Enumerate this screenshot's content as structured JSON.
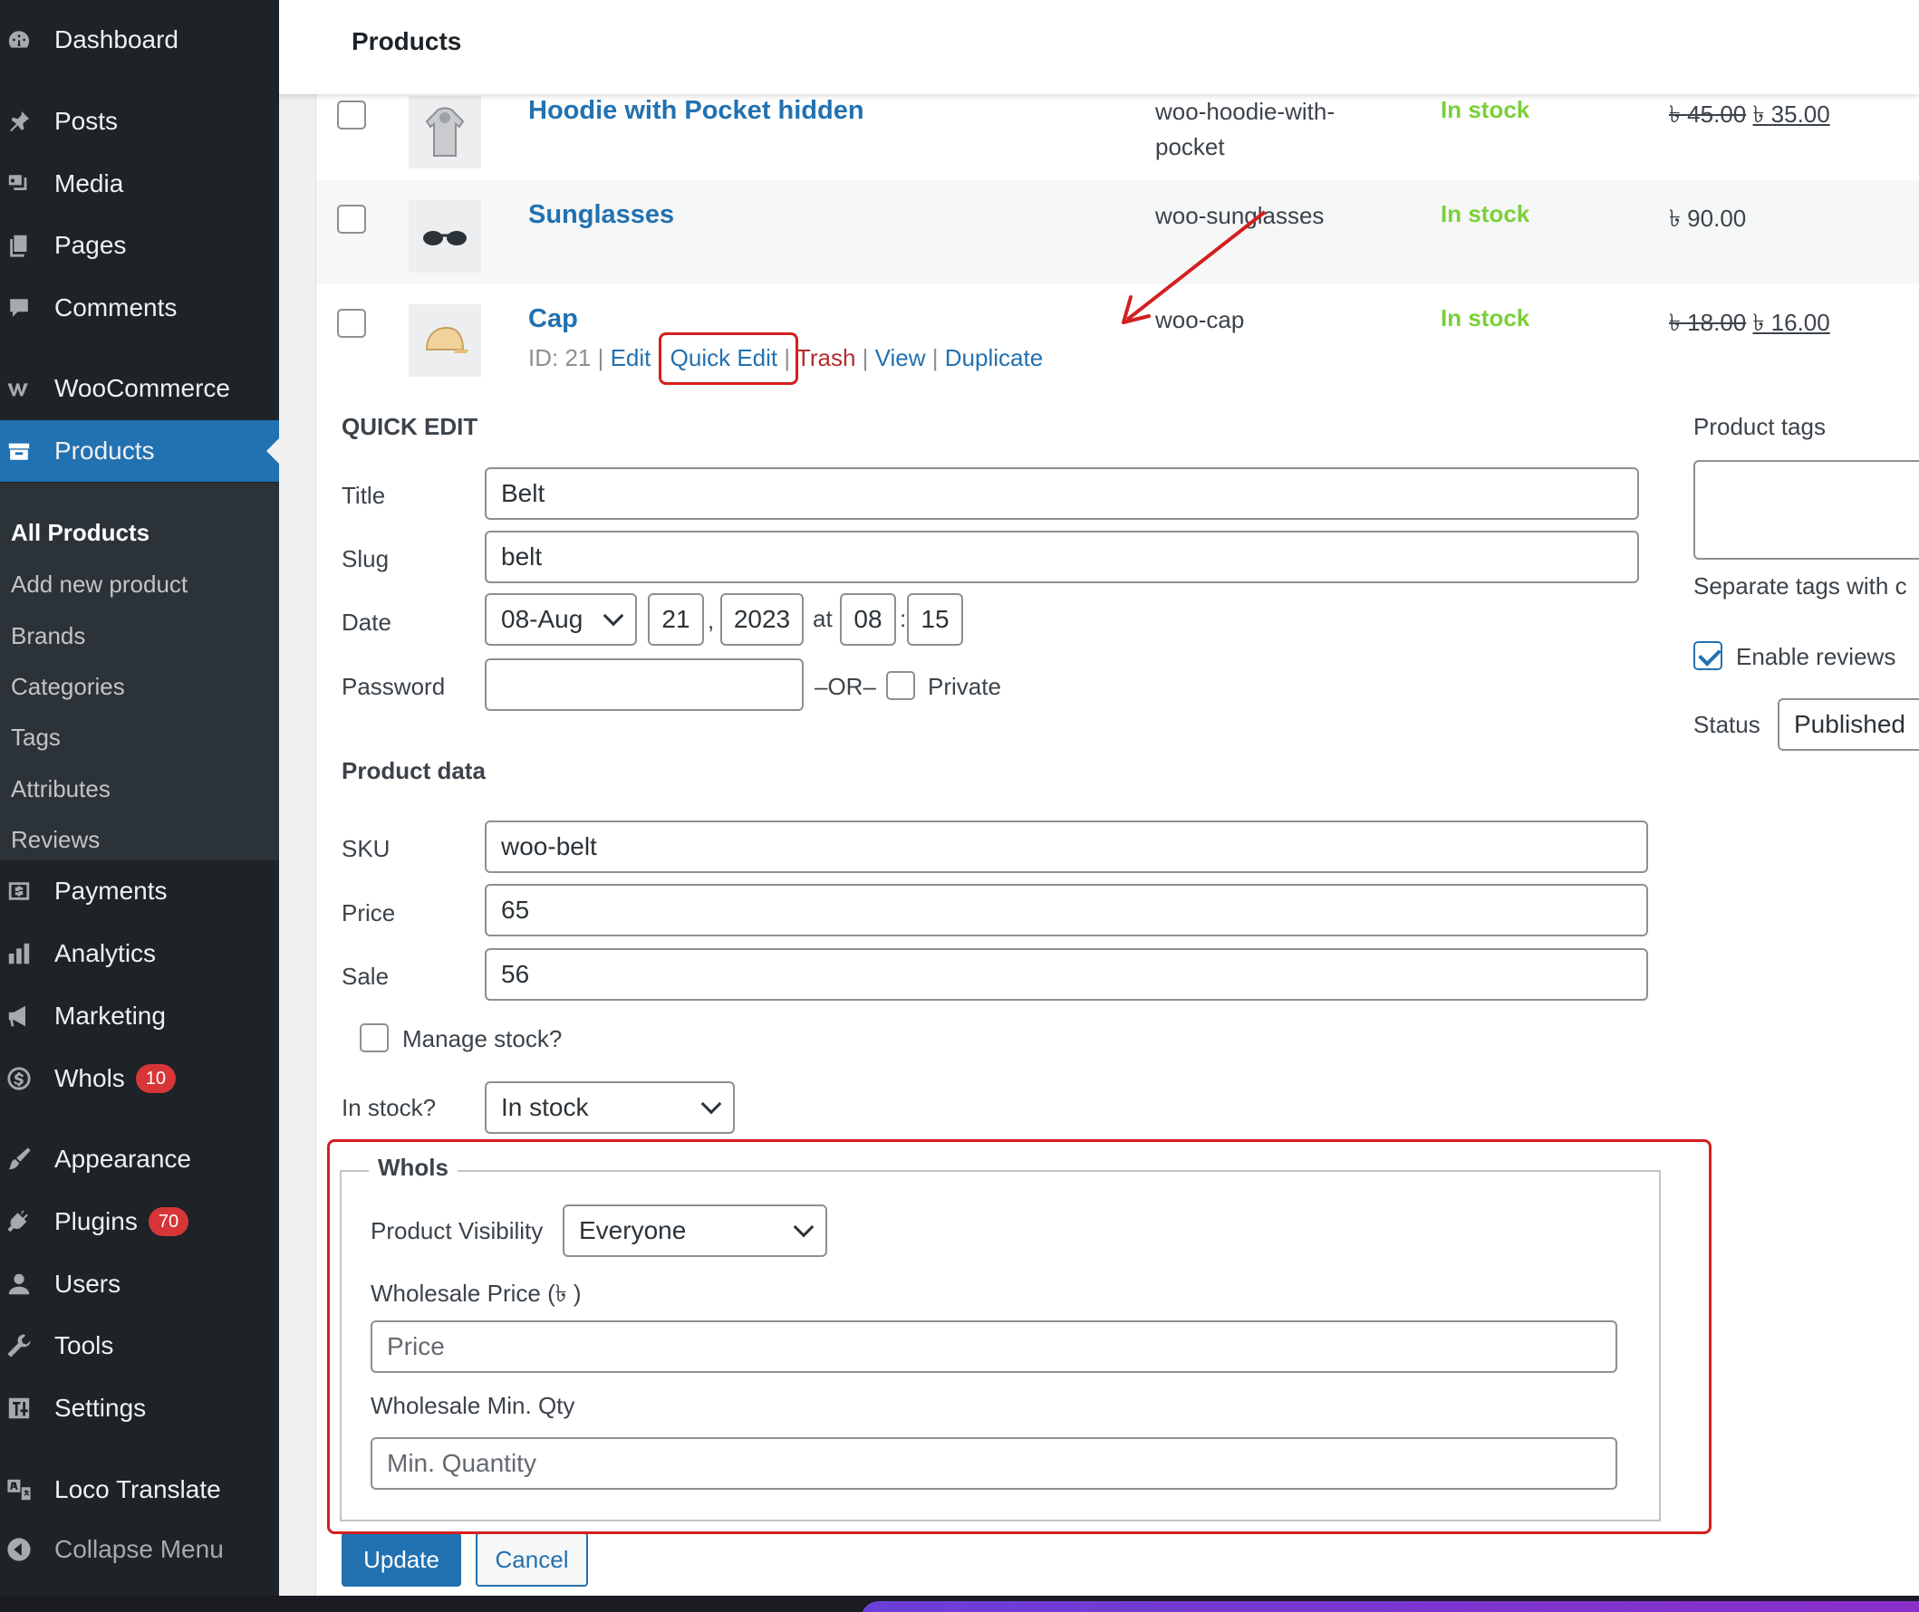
{
  "topbar": {
    "title": "Products"
  },
  "sidebar": {
    "items": [
      {
        "label": "Dashboard",
        "icon": "dashboard-icon"
      },
      {
        "label": "Posts",
        "icon": "pin-icon"
      },
      {
        "label": "Media",
        "icon": "media-icon"
      },
      {
        "label": "Pages",
        "icon": "pages-icon"
      },
      {
        "label": "Comments",
        "icon": "comment-icon"
      },
      {
        "label": "WooCommerce",
        "icon": "woo-icon"
      },
      {
        "label": "Products",
        "icon": "archive-icon"
      },
      {
        "label": "Payments",
        "icon": "dollar-box-icon"
      },
      {
        "label": "Analytics",
        "icon": "bar-chart-icon"
      },
      {
        "label": "Marketing",
        "icon": "megaphone-icon"
      },
      {
        "label": "Whols",
        "icon": "dollar-circle-icon",
        "badge": "10"
      },
      {
        "label": "Appearance",
        "icon": "brush-icon"
      },
      {
        "label": "Plugins",
        "icon": "plug-icon",
        "badge": "70"
      },
      {
        "label": "Users",
        "icon": "user-icon"
      },
      {
        "label": "Tools",
        "icon": "wrench-icon"
      },
      {
        "label": "Settings",
        "icon": "settings-icon"
      },
      {
        "label": "Loco Translate",
        "icon": "translate-icon"
      },
      {
        "label": "Collapse Menu",
        "icon": "collapse-icon"
      }
    ],
    "submenu": [
      "All Products",
      "Add new product",
      "Brands",
      "Categories",
      "Tags",
      "Attributes",
      "Reviews"
    ]
  },
  "products": [
    {
      "name": "Hoodie with Pocket hidden",
      "sku": "woo-hoodie-with-pocket",
      "stock": "In stock",
      "regular_price": "৳ 45.00",
      "sale_price": "৳ 35.00"
    },
    {
      "name": "Sunglasses",
      "sku": "woo-sunglasses",
      "stock": "In stock",
      "price": "৳ 90.00"
    },
    {
      "name": "Cap",
      "sku": "woo-cap",
      "stock": "In stock",
      "regular_price": "৳ 18.00",
      "sale_price": "৳ 16.00"
    }
  ],
  "row_actions": {
    "id_text": "ID: 21 |",
    "edit": "Edit",
    "quick_edit": "Quick Edit",
    "trash": "Trash",
    "view": "View",
    "duplicate": "Duplicate",
    "sep": "|"
  },
  "quick_edit": {
    "heading": "QUICK EDIT",
    "title_label": "Title",
    "title_value": "Belt",
    "slug_label": "Slug",
    "slug_value": "belt",
    "date_label": "Date",
    "month": "08-Aug",
    "day": "21",
    "comma": ",",
    "year": "2023",
    "at": "at",
    "hour": "08",
    "colon": ":",
    "minute": "15",
    "password_label": "Password",
    "or_text": "–OR–",
    "private_label": "Private",
    "product_data_heading": "Product data",
    "sku_label": "SKU",
    "sku_value": "woo-belt",
    "price_label": "Price",
    "price_value": "65",
    "sale_label": "Sale",
    "sale_value": "56",
    "manage_stock_label": "Manage stock?",
    "in_stock_label": "In stock?",
    "in_stock_value": "In stock",
    "tags_label": "Product tags",
    "tags_help": "Separate tags with c",
    "enable_reviews_label": "Enable reviews",
    "status_label": "Status",
    "status_value": "Published",
    "update_button": "Update",
    "cancel_button": "Cancel"
  },
  "whols": {
    "legend": "Whols",
    "visibility_label": "Product Visibility",
    "visibility_value": "Everyone",
    "wholesale_price_label": "Wholesale Price (৳ )",
    "wholesale_price_placeholder": "Price",
    "min_qty_label": "Wholesale Min. Qty",
    "min_qty_placeholder": "Min. Quantity"
  },
  "colors": {
    "accent": "#2271b1",
    "sidebar_bg": "#1d2327",
    "in_stock": "#7ad03a",
    "highlight": "#d41f1f",
    "trash": "#b32d2e"
  }
}
